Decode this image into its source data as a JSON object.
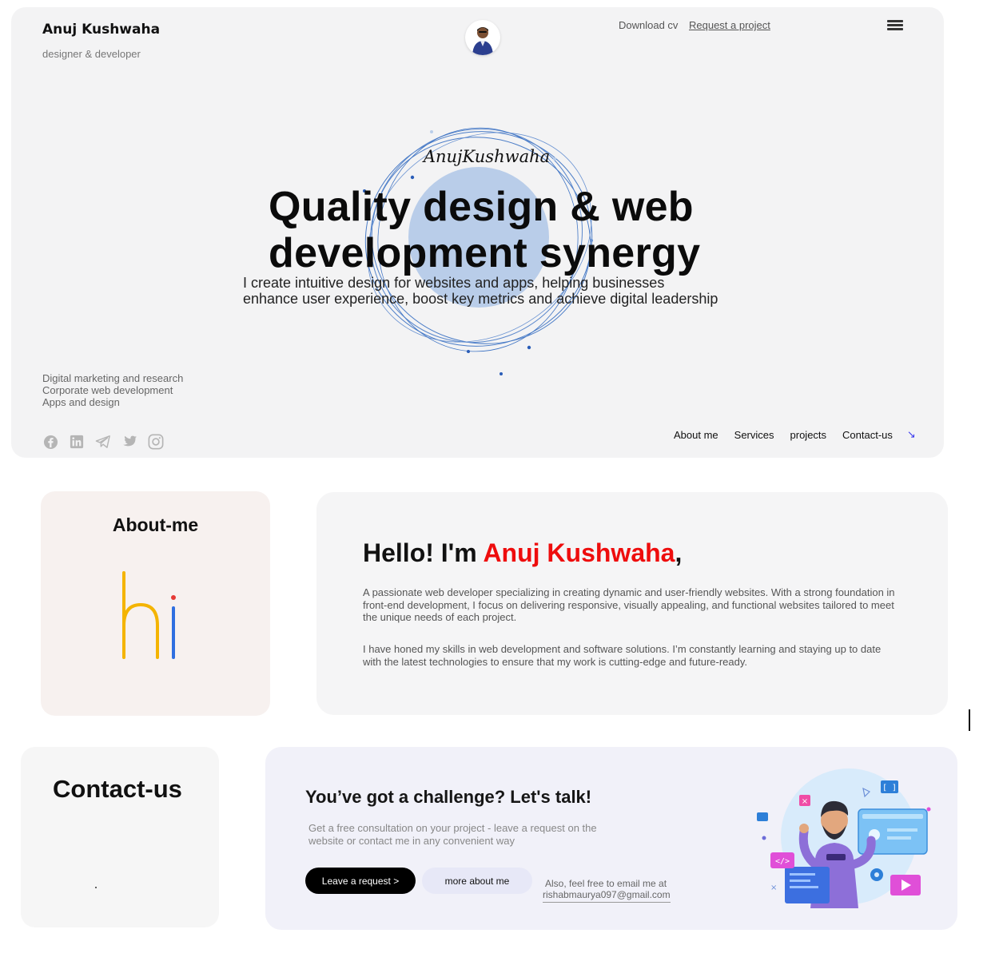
{
  "header": {
    "brand_name": "Anuj Kushwaha",
    "brand_sub": "designer & developer",
    "download_cv": "Download cv",
    "request_project": "Request a project"
  },
  "hero": {
    "signature": "AnujKushwaha",
    "headline_line1": "Quality design & web",
    "headline_line2": "development synergy",
    "subline_line1": "I create intuitive design for websites and apps, helping businesses",
    "subline_line2": "enhance user experience, boost key metrics and achieve digital leadership",
    "services": [
      "Digital marketing and research",
      "Corporate web development",
      "Apps and design"
    ],
    "socials": [
      "facebook-icon",
      "linkedin-icon",
      "telegram-icon",
      "twitter-icon",
      "instagram-icon"
    ],
    "footer_nav": [
      "About me",
      "Services",
      "projects",
      "Contact-us"
    ],
    "accent_color": "#3a6fd1"
  },
  "about": {
    "title": "About-me",
    "hello_prefix": "Hello! I'm ",
    "hello_name": "Anuj Kushwaha",
    "hello_suffix": ",",
    "paragraph1": "A passionate web developer specializing in creating dynamic and user-friendly websites. With a strong foundation in front-end development, I focus on delivering responsive, visually appealing, and functional websites tailored to meet the unique needs of each project.",
    "paragraph2": "I have honed my skills in web development and software solutions. I’m constantly learning and staying up to date with the latest technologies to ensure that my work is cutting-edge and future-ready.",
    "name_color": "#ee0d0d"
  },
  "contact": {
    "title": "Contact-us",
    "talk_title": "You’ve got a challenge? Let's talk!",
    "talk_sub": "Get a free consultation on your project - leave a request on the website or contact me in any convenient way",
    "request_button": "Leave a request >",
    "more_button": "more about me",
    "email_label": "Also, feel free to email me at",
    "email": "rishabmaurya097@gmail.com"
  }
}
